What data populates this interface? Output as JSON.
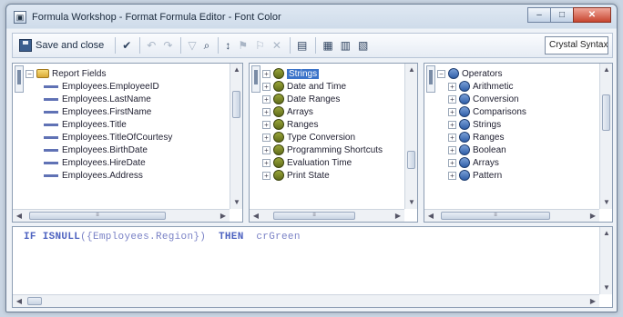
{
  "window": {
    "title": "Formula Workshop - Format Formula Editor - Font Color"
  },
  "toolbar": {
    "save_label": "Save and close",
    "syntax_value": "Crystal Syntax"
  },
  "fields_pane": {
    "root": "Report Fields",
    "items": [
      "Employees.EmployeeID",
      "Employees.LastName",
      "Employees.FirstName",
      "Employees.Title",
      "Employees.TitleOfCourtesy",
      "Employees.BirthDate",
      "Employees.HireDate",
      "Employees.Address"
    ]
  },
  "functions_pane": {
    "items": [
      "Strings",
      "Date and Time",
      "Date Ranges",
      "Arrays",
      "Ranges",
      "Type Conversion",
      "Programming Shortcuts",
      "Evaluation Time",
      "Print State"
    ],
    "selected": "Strings"
  },
  "operators_pane": {
    "root": "Operators",
    "items": [
      "Arithmetic",
      "Conversion",
      "Comparisons",
      "Strings",
      "Ranges",
      "Boolean",
      "Arrays",
      "Pattern"
    ]
  },
  "editor": {
    "kw_if": "IF",
    "fn_isnull": "ISNULL",
    "arg": "({Employees.Region})",
    "kw_then": "THEN",
    "value": "crGreen"
  }
}
